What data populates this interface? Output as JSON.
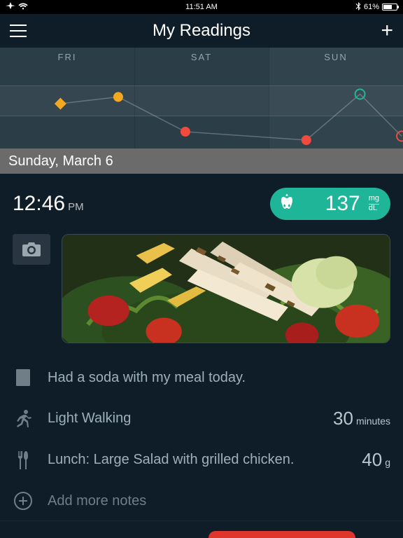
{
  "status": {
    "time": "11:51 AM",
    "battery_pct": "61%"
  },
  "nav": {
    "title": "My Readings"
  },
  "chart_data": {
    "type": "line",
    "categories": [
      "FRI",
      "SAT",
      "SUN"
    ],
    "band": {
      "low": 80,
      "high": 130
    },
    "ylim": [
      40,
      220
    ],
    "series": [
      {
        "name": "readings",
        "points": [
          {
            "day": "FRI",
            "t": 0.45,
            "value": 120,
            "marker": "diamond",
            "color": "#f2a91f"
          },
          {
            "day": "FRI",
            "t": 0.88,
            "value": 132,
            "marker": "circle",
            "color": "#f2a91f"
          },
          {
            "day": "SAT",
            "t": 0.38,
            "value": 70,
            "marker": "circle",
            "color": "#f24a3d"
          },
          {
            "day": "SUN",
            "t": 0.28,
            "value": 55,
            "marker": "circle",
            "color": "#f24a3d"
          },
          {
            "day": "SUN",
            "t": 0.68,
            "value": 137,
            "marker": "ring",
            "color": "#1fb598"
          },
          {
            "day": "SUN",
            "t": 0.99,
            "value": 62,
            "marker": "ring",
            "color": "#f24a3d"
          }
        ]
      }
    ]
  },
  "date_header": "Sunday, March 6",
  "reading": {
    "time": "12:46",
    "ampm": "PM",
    "value": "137",
    "unit_top": "mg",
    "unit_bot": "dL"
  },
  "details": {
    "note": "Had a soda with my meal today.",
    "activity_label": "Light Walking",
    "activity_value": "30",
    "activity_unit": "minutes",
    "meal_label": "Lunch: Large Salad with grilled chicken.",
    "meal_value": "40",
    "meal_unit": "g",
    "add_label": "Add more notes"
  }
}
